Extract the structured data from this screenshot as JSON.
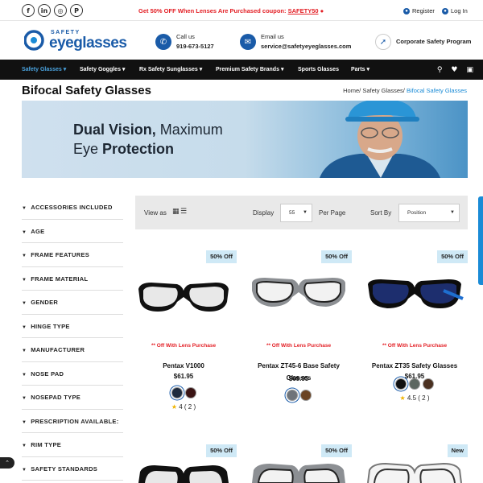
{
  "topbar": {
    "social": [
      {
        "icon": "facebook-icon",
        "glyph": "f"
      },
      {
        "icon": "linkedin-icon",
        "glyph": "in"
      },
      {
        "icon": "instagram-icon",
        "glyph": "◎"
      },
      {
        "icon": "pinterest-icon",
        "glyph": "P"
      }
    ],
    "promo_text": "Get 50% OFF When Lenses Are Purchased coupon:",
    "promo_code": "SAFETY50",
    "register": "Register",
    "login": "Log In"
  },
  "header": {
    "logo_top": "SAFETY",
    "logo_main": "eyeglasses",
    "call_label": "Call us",
    "call_value": "919-673-5127",
    "email_label": "Email us",
    "email_value": "service@safetyeyeglasses.com",
    "corporate": "Corporate Safety Program"
  },
  "nav": {
    "items": [
      {
        "label": "Safety Glasses"
      },
      {
        "label": "Safety Goggles"
      },
      {
        "label": "Rx Safety Sunglasses"
      },
      {
        "label": "Premium Safety Brands"
      },
      {
        "label": "Sports Glasses"
      },
      {
        "label": "Parts"
      }
    ]
  },
  "page": {
    "title": "Bifocal Safety Glasses",
    "breadcrumb": [
      "Home",
      "Safety Glasses",
      "Bifocal Safety Glasses"
    ],
    "banner_line1_bold": "Dual Vision,",
    "banner_line1_rest": " Maximum",
    "banner_line2_start": "Eye ",
    "banner_line2_bold": "Protection"
  },
  "filters": [
    "ACCESSORIES INCLUDED",
    "AGE",
    "FRAME FEATURES",
    "FRAME MATERIAL",
    "GENDER",
    "HINGE TYPE",
    "MANUFACTURER",
    "NOSE PAD",
    "NOSEPAD TYPE",
    "PRESCRIPTION AVAILABLE:",
    "RIM TYPE",
    "SAFETY STANDARDS"
  ],
  "toolbar": {
    "view_as": "View as",
    "display": "Display",
    "display_value": "55",
    "per_page": "Per Page",
    "sort_by": "Sort By",
    "sort_value": "Position"
  },
  "products": [
    {
      "badge": "50% Off",
      "note": "** Off With Lens Purchase",
      "name": "Pentax V1000",
      "price": "$61.95",
      "colors": [
        "#1e2b3d",
        "#3a1414"
      ],
      "rating": "4",
      "reviews": "( 2 )"
    },
    {
      "badge": "50% Off",
      "note": "** Off With Lens Purchase",
      "name": "Pentax ZT45-6 Base Safety Glasses",
      "price": "$69.95",
      "colors": [
        "#6f747a",
        "#6b4423"
      ],
      "rating": "",
      "reviews": ""
    },
    {
      "badge": "50% Off",
      "note": "** Off With Lens Purchase",
      "name": "Pentax ZT35 Safety Glasses",
      "price": "$61.95",
      "colors": [
        "#101010",
        "#5c6660",
        "#4a3020"
      ],
      "rating": "4.5",
      "reviews": "( 2 )"
    },
    {
      "badge": "50% Off"
    },
    {
      "badge": "50% Off"
    },
    {
      "badge": "New"
    }
  ]
}
